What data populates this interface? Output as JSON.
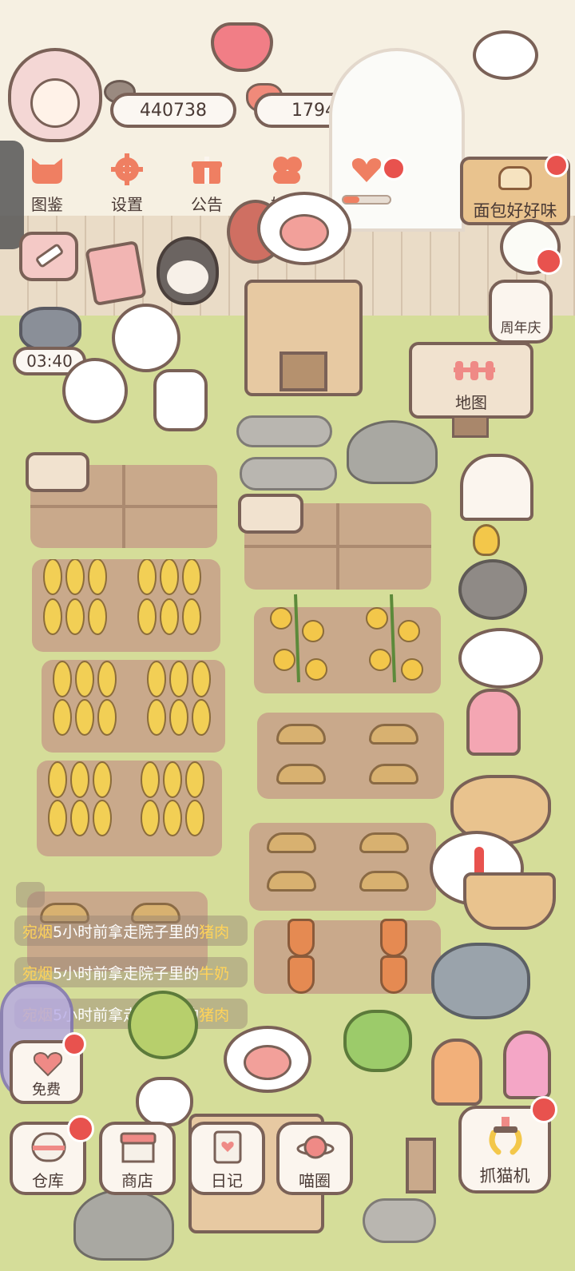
{
  "currency": {
    "coins": "440738",
    "hearts": "1794"
  },
  "menu": [
    {
      "label": "图鉴",
      "icon": "cat-head-icon"
    },
    {
      "label": "设置",
      "icon": "gear-icon"
    },
    {
      "label": "公告",
      "icon": "gift-icon"
    },
    {
      "label": "好友",
      "icon": "friends-icon"
    }
  ],
  "event_banner": "面包好好味",
  "anniversary": "周年庆",
  "map_sign": "地图",
  "timer": "03:40",
  "messages": [
    {
      "user": "宛烟",
      "middle": "5小时前拿走院子里的",
      "item": "猪肉"
    },
    {
      "user": "宛烟",
      "middle": "5小时前拿走院子里的",
      "item": "牛奶"
    },
    {
      "user": "宛烟",
      "middle": "5小时前拿走院子里的",
      "item": "猪肉"
    }
  ],
  "free_button": "免费",
  "bottom_bar": [
    {
      "label": "仓库",
      "icon": "warehouse-icon"
    },
    {
      "label": "商店",
      "icon": "shop-icon"
    },
    {
      "label": "日记",
      "icon": "diary-icon"
    },
    {
      "label": "喵圈",
      "icon": "cat-planet-icon"
    }
  ],
  "claw_machine": "抓猫机",
  "colors": {
    "accent_red": "#e8524e",
    "outline": "#7a6157",
    "ground": "#d5dd99",
    "soil": "#c9a98b"
  }
}
